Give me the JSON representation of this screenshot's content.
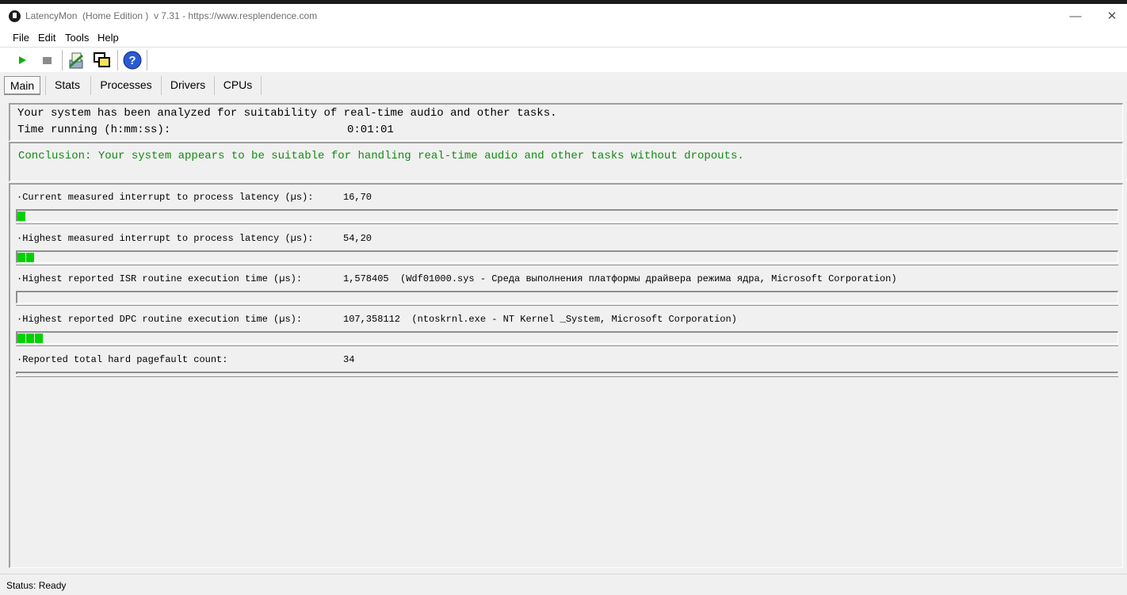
{
  "window": {
    "title": "LatencyMon  (Home Edition )  v 7.31 - https://www.resplendence.com",
    "minimize_glyph": "—",
    "maximize_glyph": "☐",
    "close_glyph": "✕"
  },
  "menu": {
    "items": [
      {
        "label": "File"
      },
      {
        "label": "Edit"
      },
      {
        "label": "Tools"
      },
      {
        "label": "Help"
      }
    ]
  },
  "toolbar": {
    "buttons": [
      "play-icon",
      "stop-icon",
      "report-icon",
      "windows-icon",
      "help-icon"
    ],
    "help_glyph": "?"
  },
  "tabs": [
    {
      "label": "Main",
      "active": true
    },
    {
      "label": "Stats",
      "active": false
    },
    {
      "label": "Processes",
      "active": false
    },
    {
      "label": "Drivers",
      "active": false
    },
    {
      "label": "CPUs",
      "active": false
    }
  ],
  "summary": {
    "line1": "Your system has been analyzed for suitability of real-time audio and other tasks.",
    "time_label": "Time running (h:mm:ss):",
    "time_value": "0:01:01"
  },
  "conclusion": "Conclusion: Your system appears to be suitable for handling real-time audio and other tasks without dropouts.",
  "conclusion_color": "#138a13",
  "meter_color": "#00d100",
  "metrics": [
    {
      "label": "·Current measured interrupt to process latency (µs):",
      "value": "16,70",
      "segments": 1
    },
    {
      "label": "·Highest measured interrupt to process latency (µs):",
      "value": "54,20",
      "segments": 2
    },
    {
      "label": "·Highest reported ISR routine execution time (µs):",
      "value": "1,578405  (Wdf01000.sys - Среда выполнения платформы драйвера режима ядра, Microsoft Corporation)",
      "segments": 0
    },
    {
      "label": "·Highest reported DPC routine execution time (µs):",
      "value": "107,358112  (ntoskrnl.exe - NT Kernel _System, Microsoft Corporation)",
      "segments": 3
    },
    {
      "label": "·Reported total hard pagefault count:",
      "value": "34",
      "segments": 0
    }
  ],
  "status": "Status: Ready"
}
